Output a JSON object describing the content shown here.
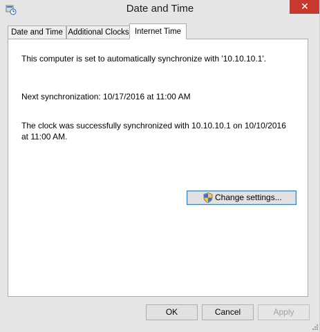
{
  "window": {
    "title": "Date and Time",
    "close_label": "✕"
  },
  "tabs": [
    {
      "label": "Date and Time",
      "active": false
    },
    {
      "label": "Additional Clocks",
      "active": false
    },
    {
      "label": "Internet Time",
      "active": true
    }
  ],
  "panel": {
    "sync_status": "This computer is set to automatically synchronize with '10.10.10.1'.",
    "next_sync": "Next synchronization: 10/17/2016 at 11:00 AM",
    "last_sync": "The clock was successfully synchronized with 10.10.10.1 on 10/10/2016 at 11:00 AM.",
    "change_settings_label": "Change settings..."
  },
  "buttons": {
    "ok": "OK",
    "cancel": "Cancel",
    "apply": "Apply"
  },
  "icons": {
    "app": "date-time-icon",
    "shield": "uac-shield-icon"
  }
}
